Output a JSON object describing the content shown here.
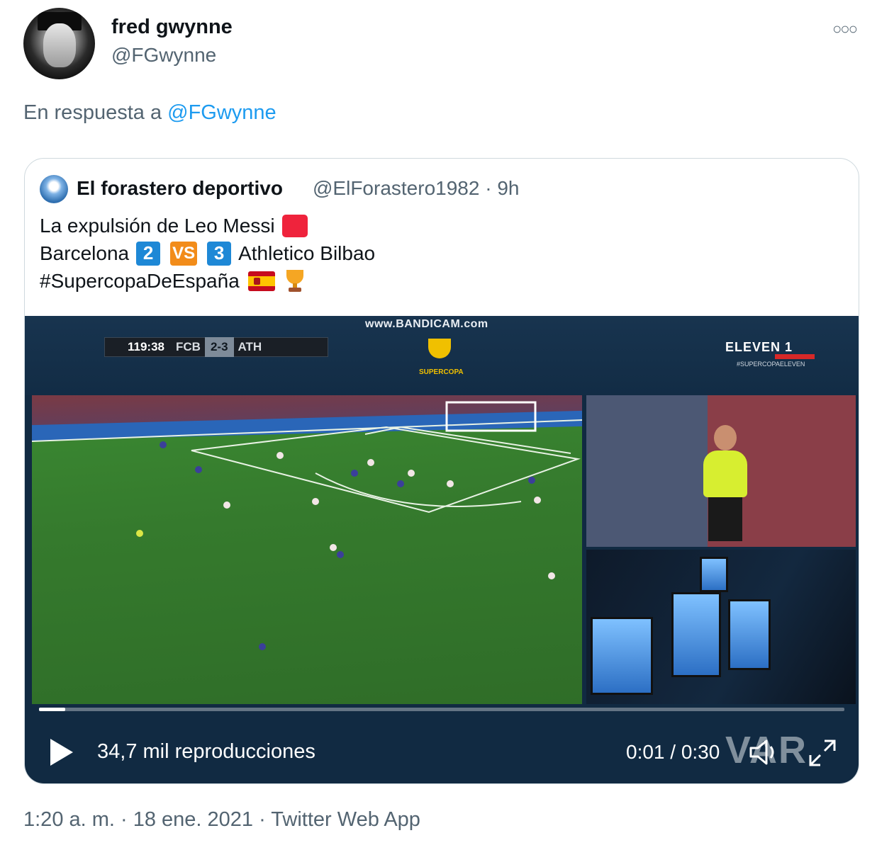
{
  "author": {
    "name": "fred gwynne",
    "handle": "@FGwynne"
  },
  "reply": {
    "prefix": "En respuesta a",
    "mention": "@FGwynne"
  },
  "quoted_tweet": {
    "author_name": "El forastero deportivo",
    "author_handle_time": "@ElForastero1982 · 9h",
    "line1": "La expulsión de Leo Messi",
    "line2_team_a": "Barcelona",
    "score_a": "2",
    "vs": "VS",
    "score_b": "3",
    "line2_team_b": "Athletico Bilbao",
    "hashtag": "#SupercopaDeEspaña"
  },
  "video": {
    "watermark": "www.BANDICAM.com",
    "scoreboard": {
      "clock": "119:38",
      "home": "FCB",
      "score": "2-3",
      "away": "ATH"
    },
    "supercopa_label": "SUPERCOPA",
    "broadcaster": "ELEVEN 1",
    "broadcaster_tag": "#SUPERCOPAELEVEN",
    "var_label": "VAR",
    "views": "34,7 mil reproducciones",
    "time": "0:01 / 0:30",
    "progress": 0.033
  },
  "footer": "1:20 a. m. · 18 ene. 2021 · Twitter Web App",
  "colors": {
    "link": "#1d9bf0",
    "secondary_text": "#536471",
    "red_card": "#ef233c",
    "score_badge": "#1e88d6",
    "vs_badge": "#f28c1a"
  }
}
